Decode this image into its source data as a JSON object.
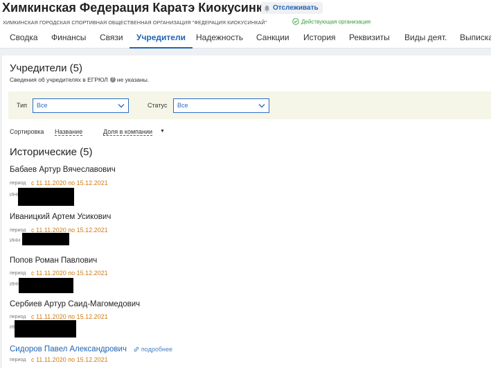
{
  "org": {
    "title": "Химкинская Федерация Каратэ Киокусинкай",
    "follow_label": "Отслеживать",
    "full_name": "ХИМКИНСКАЯ ГОРОДСКАЯ СПОРТИВНАЯ ОБЩЕСТВЕННАЯ ОРГАНИЗАЦИЯ \"ФЕДЕРАЦИЯ КИОКУСИНКАЙ\"",
    "status": "Действующая организация"
  },
  "tabs": [
    {
      "label": "Сводка"
    },
    {
      "label": "Финансы"
    },
    {
      "label": "Связи"
    },
    {
      "label": "Учредители"
    },
    {
      "label": "Надежность"
    },
    {
      "label": "Санкции"
    },
    {
      "label": "История"
    },
    {
      "label": "Реквизиты"
    },
    {
      "label": "Виды деят."
    },
    {
      "label": "Выписка"
    }
  ],
  "section": {
    "title": "Учредители (5)",
    "note_before": "Сведения об учредителях в ЕГРЮЛ",
    "note_after": "не указаны."
  },
  "filters": {
    "type_label": "Тип",
    "type_value": "Все",
    "status_label": "Статус",
    "status_value": "Все"
  },
  "sort": {
    "label": "Сортировка",
    "options": [
      "Название",
      "Доля в компании"
    ]
  },
  "historical": {
    "title": "Исторические (5)",
    "period_label": "период",
    "inn_label": "ИНН",
    "people": [
      {
        "name": "Бабаев Артур Вячеславович",
        "period": "с 11.11.2020 по 15.12.2021"
      },
      {
        "name": "Иваницкий Артем Усикович",
        "period": "с 11.11.2020 по 15.12.2021"
      },
      {
        "name": "Попов Роман Павлович",
        "period": "с 11.11.2020 по 15.12.2021"
      },
      {
        "name": "Сербиев Артур Саид-Магомедович",
        "period": "с 11.11.2020 по 15.12.2021"
      },
      {
        "name": "Сидоров Павел Александрович",
        "period": "с 11.11.2020 по 15.12.2021",
        "more_label": "подробнее"
      }
    ]
  }
}
